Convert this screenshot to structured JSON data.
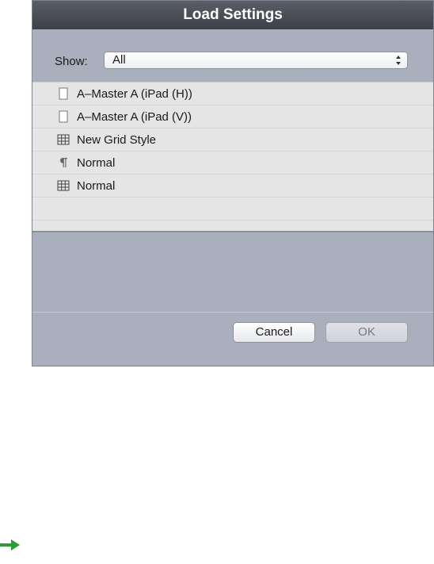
{
  "dialog": {
    "title": "Load Settings"
  },
  "show": {
    "label": "Show:",
    "selected": "All"
  },
  "list": {
    "items": [
      {
        "icon": "page-icon",
        "label": "A–Master A (iPad (H))"
      },
      {
        "icon": "page-icon",
        "label": "A–Master A (iPad (V))"
      },
      {
        "icon": "grid-icon",
        "label": "New Grid Style"
      },
      {
        "icon": "paragraph-icon",
        "label": "Normal"
      },
      {
        "icon": "grid-icon",
        "label": "Normal"
      }
    ]
  },
  "buttons": {
    "cancel_label": "Cancel",
    "ok_label": "OK"
  },
  "colors": {
    "dialog_bg": "#a9afbd",
    "titlebar": "#3d4047",
    "list_bg": "#e5e5e5",
    "arrow": "#2e9a3a"
  }
}
